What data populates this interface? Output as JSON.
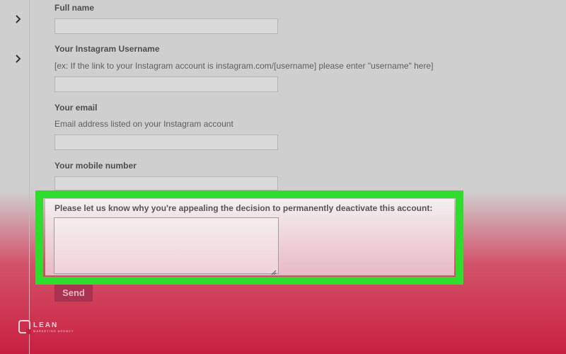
{
  "sidebar": {
    "chevrons": [
      "chevron-right-icon",
      "chevron-right-icon"
    ]
  },
  "form": {
    "full_name": {
      "label": "Full name",
      "value": ""
    },
    "instagram_username": {
      "label": "Your Instagram Username",
      "hint": "[ex: If the link to your Instagram account is instagram.com/[username] please enter \"username\" here]",
      "value": ""
    },
    "email": {
      "label": "Your email",
      "hint": "Email address listed on your Instagram account",
      "value": ""
    },
    "mobile": {
      "label": "Your mobile number",
      "value": ""
    },
    "appeal": {
      "label": "Please let us know why you're appealing the decision to permanently deactivate this account:",
      "value": ""
    },
    "send_label": "Send"
  },
  "watermark": {
    "main": "LEAN",
    "sub": "MARKETING AGENCY"
  },
  "colors": {
    "highlight": "#2fdd2f",
    "send_button": "#a8324f",
    "background": "#cfcfcf",
    "gradient_bottom": "#c8203f"
  }
}
